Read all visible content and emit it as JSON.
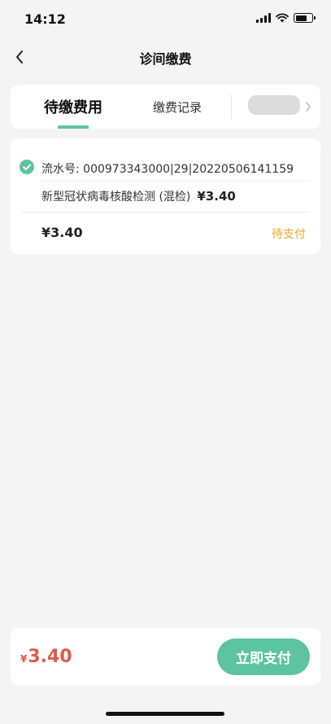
{
  "status_bar": {
    "time": "14:12",
    "battery_level": 0.7
  },
  "nav": {
    "title": "诊间缴费",
    "back_icon": "chevron-left-icon"
  },
  "tabs": [
    {
      "label": "待缴费用",
      "active": true
    },
    {
      "label": "缴费记录",
      "active": false
    }
  ],
  "bill": {
    "serial_label": "流水号: 000973343000|29|20220506141159",
    "items": [
      {
        "name": "新型冠状病毒核酸检测 (混检)",
        "price": "¥3.40"
      }
    ],
    "total": "¥3.40",
    "status": "待支付",
    "selected": true
  },
  "pay_bar": {
    "currency": "¥",
    "amount": "3.40",
    "button_label": "立即支付"
  },
  "colors": {
    "accent": "#5cc4a0",
    "price_red": "#e05a4a",
    "status_orange": "#f5a623",
    "background": "#f4f4f4"
  }
}
